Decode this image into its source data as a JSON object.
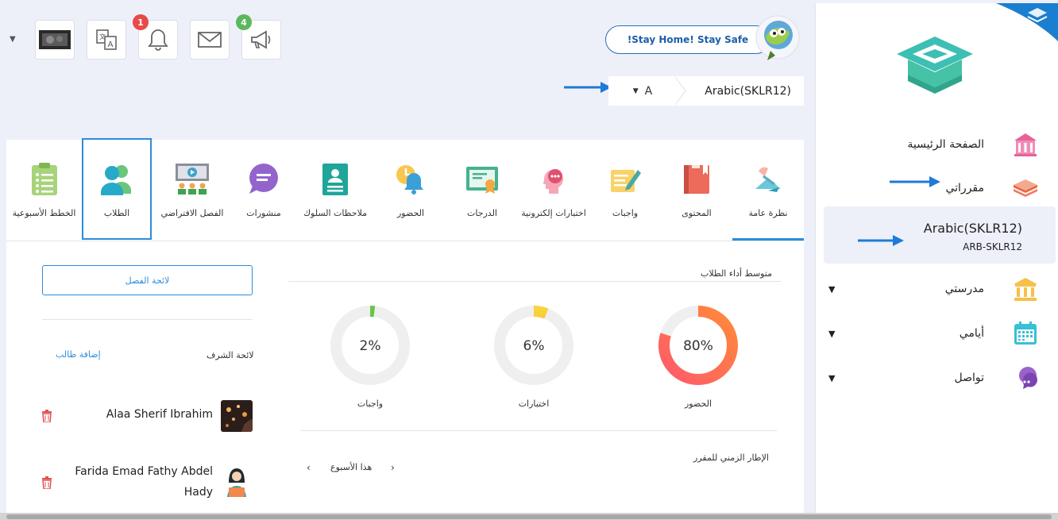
{
  "header": {
    "stay_home": "!Stay Home! Stay Safe",
    "notifications_count": "1",
    "announcements_count": "4"
  },
  "breadcrumb": {
    "section": "A",
    "course": "Arabic(SKLR12)"
  },
  "sidebar": {
    "home": "الصفحة الرئيسية",
    "my_courses": "مقرراتي",
    "course_name": "Arabic(SKLR12)",
    "course_code": "ARB-SKLR12",
    "my_school": "مدرستي",
    "my_days": "أيامي",
    "communicate": "تواصل"
  },
  "tabs": [
    {
      "label": "نظرة عامة",
      "icon": "overview-icon"
    },
    {
      "label": "المحتوى",
      "icon": "book-icon"
    },
    {
      "label": "واجبات",
      "icon": "assignment-icon"
    },
    {
      "label": "اختبارات إلكترونية",
      "icon": "quiz-icon"
    },
    {
      "label": "الدرجات",
      "icon": "certificate-icon"
    },
    {
      "label": "الحضور",
      "icon": "alarm-icon"
    },
    {
      "label": "ملاحظات السلوك",
      "icon": "badge-icon"
    },
    {
      "label": "منشورات",
      "icon": "chat-icon"
    },
    {
      "label": "الفصل الافتراضي",
      "icon": "virtual-class-icon"
    },
    {
      "label": "الطلاب",
      "icon": "students-icon"
    },
    {
      "label": "الخطط الأسبوعية",
      "icon": "clipboard-icon"
    }
  ],
  "performance": {
    "title": "متوسط أداء الطلاب",
    "attendance": {
      "label": "الحضور",
      "value": "80%",
      "fraction": 0.8
    },
    "quizzes": {
      "label": "اختبارات",
      "value": "6%",
      "fraction": 0.06
    },
    "assignments": {
      "label": "واجبات",
      "value": "2%",
      "fraction": 0.02
    }
  },
  "timeline": {
    "title": "الإطار الزمني للمقرر",
    "week": "هذا الأسبوع"
  },
  "students": {
    "class_list_button": "لائحة الفصل",
    "honor_list": "لائحة الشرف",
    "add_student": "إضافة طالب",
    "items": [
      {
        "name": "Alaa Sherif Ibrahim"
      },
      {
        "name_line1": "Farida Emad Fathy Abdel",
        "name_line2": "Hady"
      }
    ]
  },
  "colors": {
    "accent": "#2d8cda",
    "attendance": "#ff6b57",
    "quizzes": "#f5c242",
    "assignments": "#6cc34b"
  }
}
